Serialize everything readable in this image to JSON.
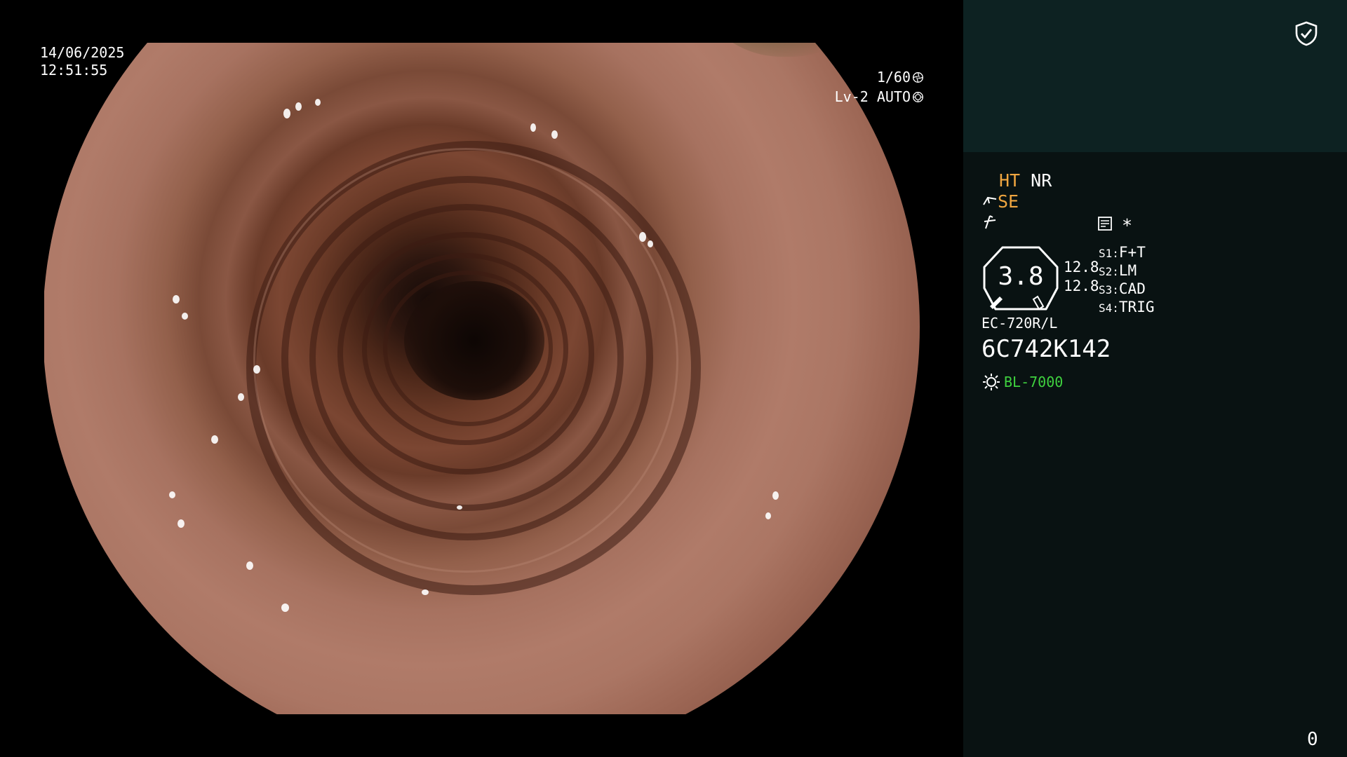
{
  "overlay": {
    "date": "14/06/2025",
    "time": "12:51:55",
    "shutter": "1/60",
    "shutter_icon": "aperture-icon",
    "level": "Lv-2 AUTO",
    "level_icon": "iris-icon"
  },
  "panel": {
    "shield_icon": "shield-check-icon",
    "ht": "HT",
    "nr": "NR",
    "se": "SE",
    "tool_icon": "scope-tool-icon",
    "edge_icon": "edge-enhance-icon",
    "memo_icon": "memo-icon",
    "asterisk": "*",
    "gauge_value": "3.8",
    "gauge_left": "12.8",
    "gauge_right": "12.8",
    "switches": [
      {
        "key": "S1:",
        "value": "F+T"
      },
      {
        "key": "S2:",
        "value": "LM"
      },
      {
        "key": "S3:",
        "value": "CAD"
      },
      {
        "key": "S4:",
        "value": "TRIG"
      }
    ],
    "scope_model": "EC-720R/L",
    "serial": "6C742K142",
    "light_icon": "light-source-icon",
    "light_source": "BL-7000",
    "corner_number": "0"
  },
  "colors": {
    "panel_bg": "#091212",
    "panel_top_bg": "#0d2222",
    "orange": "#f0a640",
    "green": "#3fd23f"
  }
}
